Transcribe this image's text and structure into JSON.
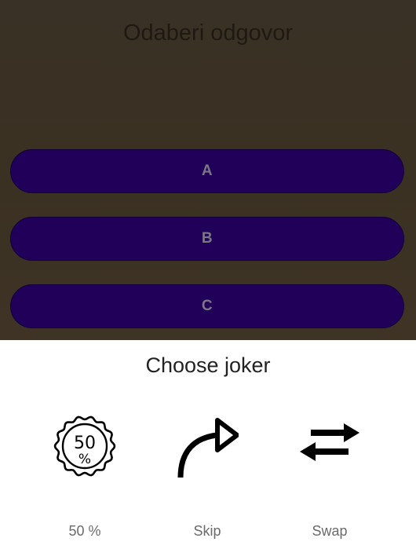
{
  "question": {
    "text": "Odaberi odgovor"
  },
  "answers": [
    {
      "label": "A"
    },
    {
      "label": "B"
    },
    {
      "label": "C"
    }
  ],
  "joker_sheet": {
    "title": "Choose joker",
    "jokers": [
      {
        "label": "50 %",
        "icon": "fifty-percent-badge-icon",
        "badge_top": "50",
        "badge_bottom": "%"
      },
      {
        "label": "Skip",
        "icon": "skip-arrow-icon"
      },
      {
        "label": "Swap",
        "icon": "swap-arrows-icon"
      }
    ]
  },
  "colors": {
    "overlay_bg": "#3b3122",
    "answer_bg": "#200058",
    "answer_text": "#7d7688",
    "sheet_bg": "#ffffff",
    "label_text": "#6a6a6a"
  }
}
